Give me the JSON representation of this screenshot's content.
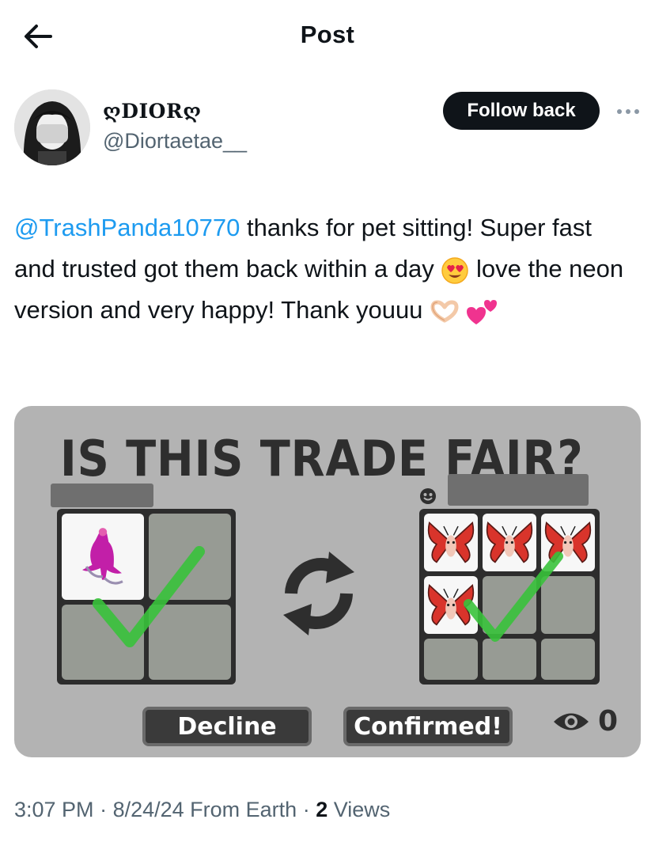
{
  "header": {
    "title": "Post",
    "back_icon": "arrow-left-icon"
  },
  "author": {
    "display_name": "ღDIORღ",
    "handle": "@Diortaetae__",
    "follow_label": "Follow back",
    "more_icon": "ellipsis-icon"
  },
  "post": {
    "mention": "@TrashPanda10770",
    "text_part1": " thanks for pet sitting! Super fast and trusted got them back within a day ",
    "text_part2": " love the neon version and very happy! Thank youuu ",
    "emojis": [
      "heart-eyes-emoji",
      "heart-hands-emoji",
      "two-hearts-emoji"
    ]
  },
  "media": {
    "title": "IS THIS TRADE FAIR?",
    "decline_label": "Decline",
    "confirmed_label": "Confirmed!",
    "viewers_count": "0",
    "left_offer": {
      "slots": 4,
      "filled": 1,
      "item": "flamingo-figure"
    },
    "right_offer": {
      "slots": 9,
      "filled": 4,
      "item": "butterfly"
    },
    "colors": {
      "background": "#b3b3b3",
      "check": "#39c23b",
      "butterfly": "#d9342b"
    }
  },
  "meta": {
    "time": "3:07 PM",
    "sep1": " · ",
    "date": "8/24/24",
    "source": " From Earth",
    "sep2": " · ",
    "views_count": "2",
    "views_label": " Views"
  }
}
